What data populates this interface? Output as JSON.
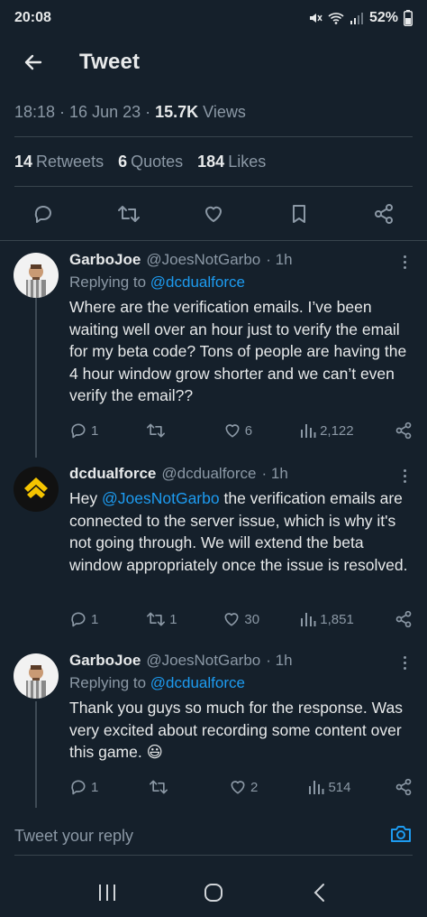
{
  "status_bar": {
    "time": "20:08",
    "battery": "52%"
  },
  "header": {
    "title": "Tweet"
  },
  "tweet_meta": {
    "time": "18:18",
    "sep1": "·",
    "date": "16 Jun 23",
    "sep2": "·",
    "views_count": "15.7K",
    "views_label": "Views"
  },
  "tweet_stats": {
    "retweets_count": "14",
    "retweets_label": "Retweets",
    "quotes_count": "6",
    "quotes_label": "Quotes",
    "likes_count": "184",
    "likes_label": "Likes"
  },
  "replies": [
    {
      "name": "GarboJoe",
      "handle": "@JoesNotGarbo",
      "time": "· 1h",
      "replying_prefix": "Replying to",
      "replying_to": "@dcdualforce",
      "text": "Where are the verification emails. I’ve been waiting well over an hour just to verify the email for my beta code? Tons of people are having the 4 hour window grow shorter and we can’t even verify the email??",
      "reply_count": "1",
      "retweet_count": "",
      "like_count": "6",
      "view_count": "2,122"
    },
    {
      "name": "dcdualforce",
      "handle": "@dcdualforce",
      "time": "· 1h",
      "text_prefix": "Hey",
      "mention": "@JoesNotGarbo",
      "text_rest": "the verification emails are connected  to the server issue, which is why it's not going through. We will extend the beta window appropriately once the issue is resolved.",
      "reply_count": "1",
      "retweet_count": "1",
      "like_count": "30",
      "view_count": "1,851"
    },
    {
      "name": "GarboJoe",
      "handle": "@JoesNotGarbo",
      "time": "· 1h",
      "replying_prefix": "Replying to",
      "replying_to": "@dcdualforce",
      "text": "Thank you guys so much for the response. Was very excited about recording some content over this game.",
      "emoji": "😃",
      "reply_count": "1",
      "retweet_count": "",
      "like_count": "2",
      "view_count": "514"
    }
  ],
  "reply_bar": {
    "placeholder": "Tweet your reply"
  },
  "colors": {
    "background": "#15202b",
    "accent": "#1d9bf0",
    "muted": "#8b98a5",
    "text": "#e7e9ea"
  },
  "icons": [
    "back-arrow-icon",
    "reply-icon",
    "retweet-icon",
    "heart-icon",
    "bookmark-icon",
    "share-icon",
    "views-icon",
    "more-icon",
    "camera-icon",
    "recents-icon",
    "home-icon",
    "nav-back-icon"
  ]
}
